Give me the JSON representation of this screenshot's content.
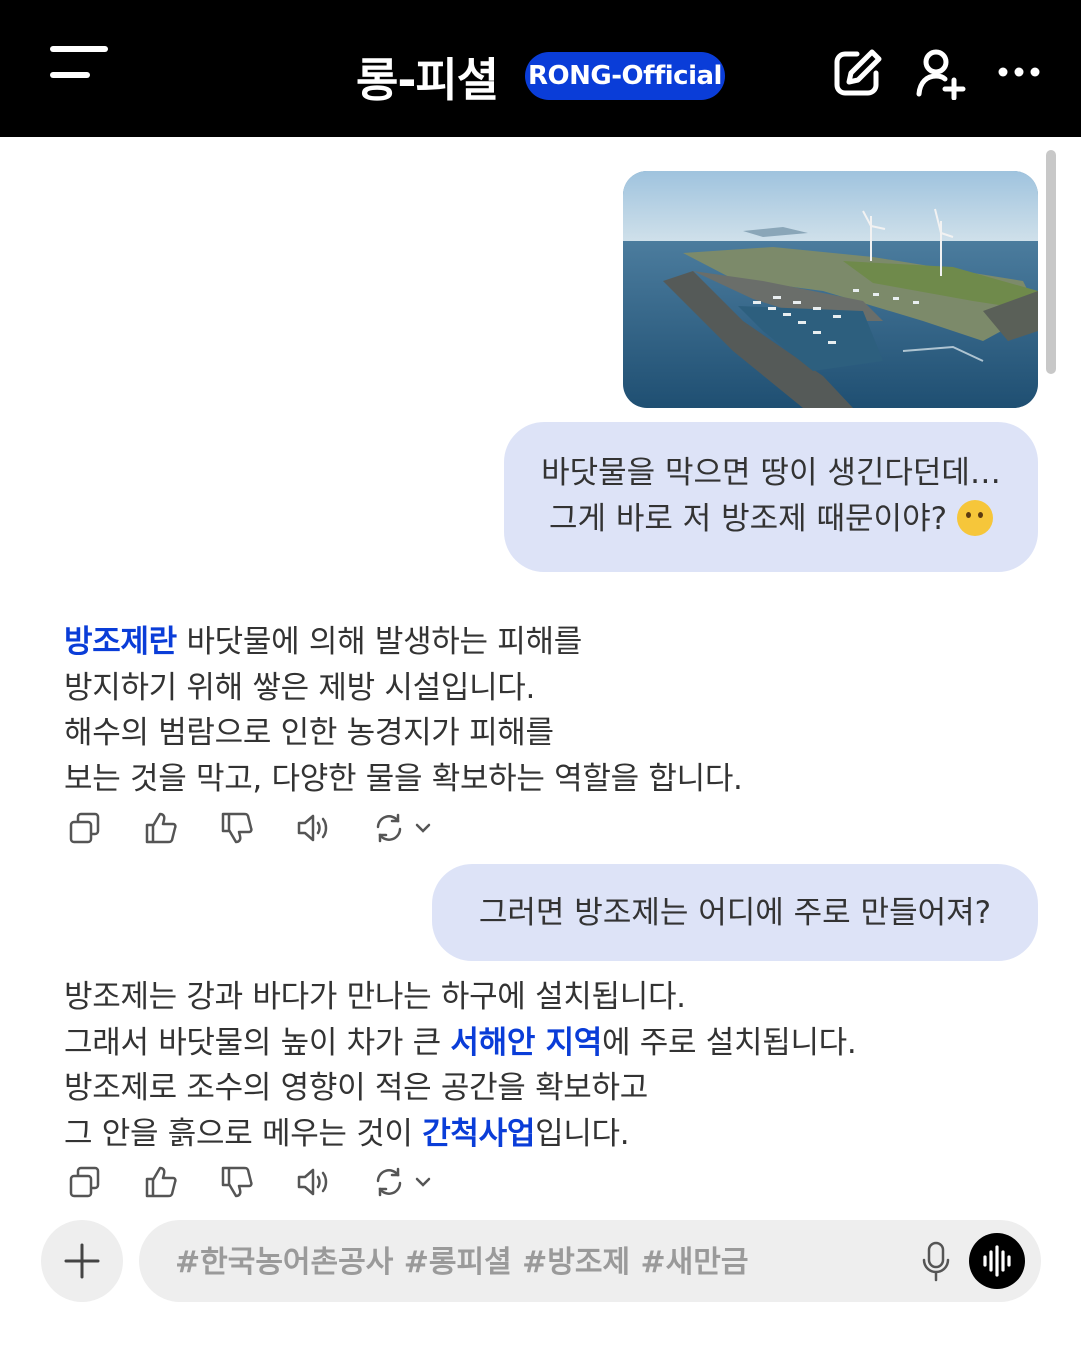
{
  "header": {
    "title": "롱-피셜",
    "badge": "RONG-Official",
    "icons": [
      "menu-icon",
      "edit-icon",
      "add-user-icon",
      "more-icon"
    ]
  },
  "messages": {
    "user1_line1": "바닷물을 막으면 땅이 생긴다던데…",
    "user1_line2": "그게 바로 저 방조제 때문이야?",
    "user1_emoji": "thinking-face",
    "answer1": {
      "highlight": "방조제란",
      "line1_rest": " 바닷물에 의해 발생하는 피해를",
      "line2": "방지하기 위해 쌓은 제방 시설입니다.",
      "line3": "해수의 범람으로 인한 농경지가 피해를",
      "line4": "보는 것을 막고, 다양한 물을 확보하는 역할을 합니다."
    },
    "user2": "그러면 방조제는 어디에 주로 만들어져?",
    "answer2": {
      "line1": "방조제는 강과 바다가 만나는 하구에 설치됩니다.",
      "line2_pre": "그래서 바닷물의 높이 차가 큰 ",
      "line2_hl": "서해안 지역",
      "line2_post": "에 주로 설치됩니다.",
      "line3": "방조제로 조수의 영향이 적은 공간을 확보하고",
      "line4_pre": "그 안을 흙으로 메우는 것이 ",
      "line4_hl": "간척사업",
      "line4_post": "입니다."
    }
  },
  "message_actions": [
    "copy-icon",
    "thumbs-up-icon",
    "thumbs-down-icon",
    "speaker-icon",
    "regenerate-icon"
  ],
  "composer": {
    "placeholder": "#한국농어촌공사 #롱피셜 #방조제 #새만금"
  },
  "colors": {
    "accent": "#0a3dd8",
    "bubble": "#dde3f7",
    "header_bg": "#000000",
    "input_bg": "#eeeeee"
  }
}
